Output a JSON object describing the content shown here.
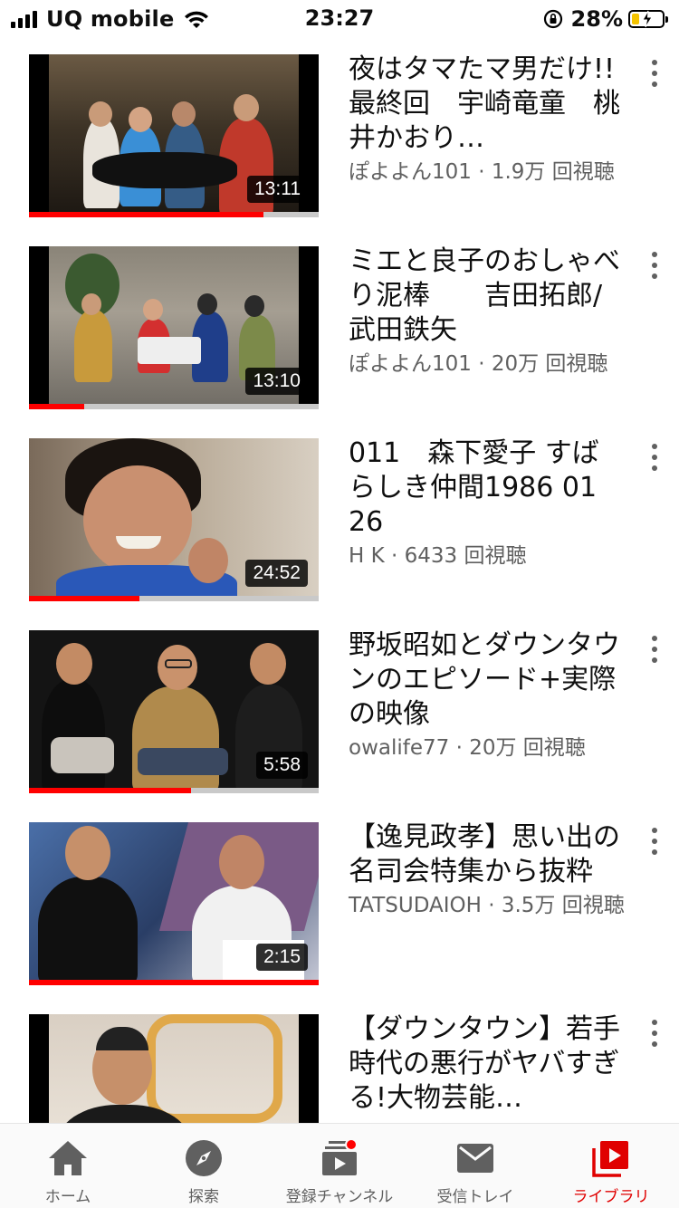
{
  "status_bar": {
    "carrier": "UQ mobile",
    "time": "23:27",
    "battery_percent": "28%",
    "battery_level": 0.28
  },
  "videos": [
    {
      "title": "夜はタマたマ男だけ!!　最終回　宇崎竜童　桃井かおり…",
      "channel_views": "ぽよよん101 · 1.9万 回視聴",
      "duration": "13:11",
      "watched_fraction": 0.81
    },
    {
      "title": "ミエと良子のおしゃべり泥棒　　吉田拓郎/武田鉄矢",
      "channel_views": "ぽよよん101 · 20万 回視聴",
      "duration": "13:10",
      "watched_fraction": 0.19
    },
    {
      "title": "011　森下愛子 すばらしき仲間1986 01 26",
      "channel_views": "H K · 6433 回視聴",
      "duration": "24:52",
      "watched_fraction": 0.38
    },
    {
      "title": "野坂昭如とダウンタウンのエピソード+実際の映像",
      "channel_views": "owalife77 · 20万 回視聴",
      "duration": "5:58",
      "watched_fraction": 0.56
    },
    {
      "title": "【逸見政孝】思い出の名司会特集から抜粋",
      "channel_views": "TATSUDAIOH · 3.5万 回視聴",
      "duration": "2:15",
      "watched_fraction": 1.0
    },
    {
      "title": "【ダウンタウン】若手時代の悪行がヤバすぎる!大物芸能…",
      "channel_views": "",
      "duration": "",
      "watched_fraction": 0
    }
  ],
  "bottom_nav": [
    {
      "label": "ホーム",
      "icon": "home-icon",
      "active": false
    },
    {
      "label": "探索",
      "icon": "compass-icon",
      "active": false
    },
    {
      "label": "登録チャンネル",
      "icon": "subscriptions-icon",
      "active": false,
      "badge": true
    },
    {
      "label": "受信トレイ",
      "icon": "mail-icon",
      "active": false
    },
    {
      "label": "ライブラリ",
      "icon": "library-icon",
      "active": true
    }
  ],
  "colors": {
    "accent": "#ff0000",
    "secondary_text": "#606060",
    "active_nav": "#e00000"
  }
}
